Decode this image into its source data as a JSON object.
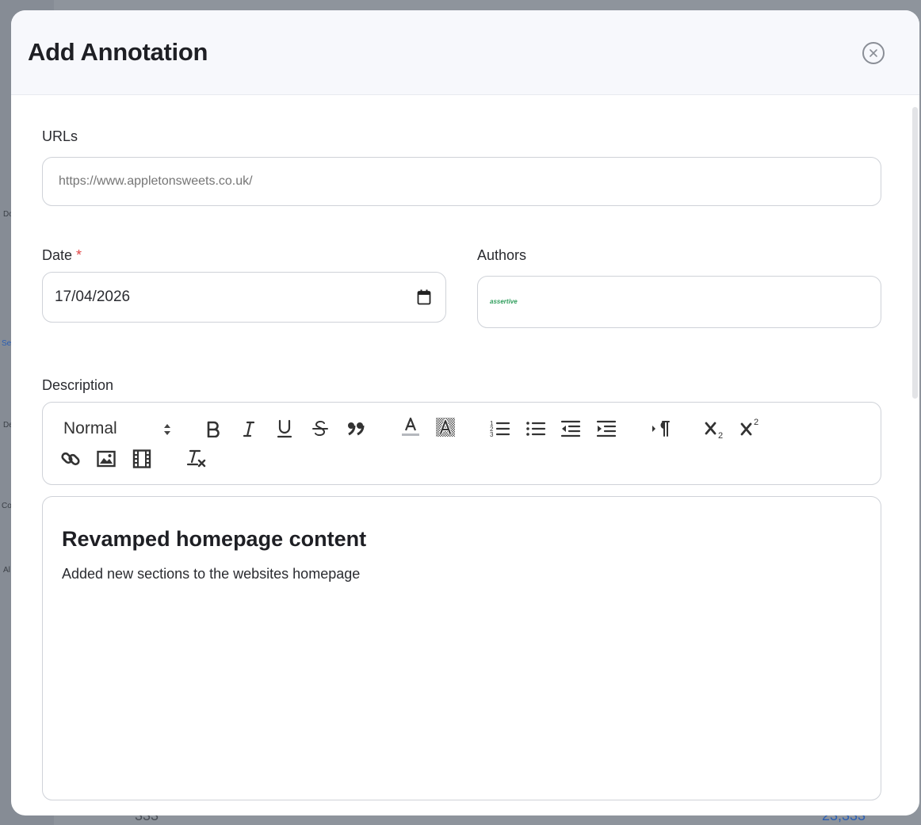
{
  "modal": {
    "title": "Add Annotation"
  },
  "form": {
    "urls_label": "URLs",
    "urls_placeholder": "https://www.appletonsweets.co.uk/",
    "date_label": "Date",
    "date_required_mark": "*",
    "date_value": "17/04/2026",
    "authors_label": "Authors",
    "author_chip": "assertive",
    "description_label": "Description"
  },
  "toolbar": {
    "format_select": "Normal",
    "buttons": [
      "bold-icon",
      "italic-icon",
      "underline-icon",
      "strikethrough-icon",
      "blockquote-icon",
      "text-color-icon",
      "highlight-icon",
      "ordered-list-icon",
      "bullet-list-icon",
      "outdent-icon",
      "indent-icon",
      "paragraph-direction-icon",
      "subscript-icon",
      "superscript-icon",
      "link-icon",
      "image-icon",
      "video-icon",
      "clear-format-icon"
    ]
  },
  "editor": {
    "heading": "Revamped homepage content",
    "paragraph": "Added new sections to the websites homepage"
  },
  "background": {
    "sidebar_fragments": [
      "Do",
      "Se",
      "De",
      "Co",
      "Al"
    ],
    "bottom_values": [
      "333",
      "23,333"
    ]
  },
  "colors": {
    "accent_green": "#2e9d5b",
    "required": "#e04646",
    "backdrop": "#8e949c"
  }
}
